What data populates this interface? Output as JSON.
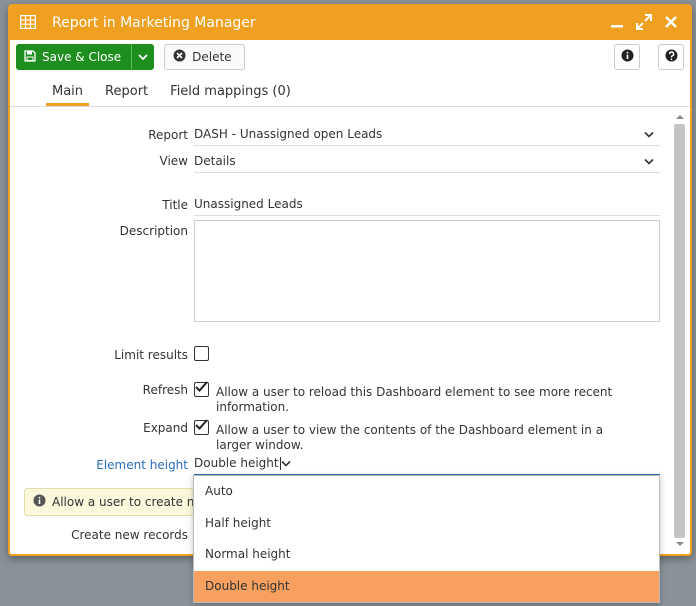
{
  "window": {
    "title": "Report in Marketing Manager"
  },
  "toolbar": {
    "save_label": "Save & Close",
    "delete_label": "Delete"
  },
  "tabs": [
    {
      "label": "Main",
      "active": true
    },
    {
      "label": "Report",
      "active": false
    },
    {
      "label": "Field mappings (0)",
      "active": false
    }
  ],
  "form": {
    "report": {
      "label": "Report",
      "value": "DASH - Unassigned open Leads"
    },
    "view": {
      "label": "View",
      "value": "Details"
    },
    "title": {
      "label": "Title",
      "value": "Unassigned Leads"
    },
    "description": {
      "label": "Description",
      "value": ""
    },
    "limit_results": {
      "label": "Limit results",
      "checked": false
    },
    "refresh": {
      "label": "Refresh",
      "checked": true,
      "text": "Allow a user to reload this Dashboard element to see more recent information."
    },
    "expand": {
      "label": "Expand",
      "checked": true,
      "text": "Allow a user to view the contents of the Dashboard element in a larger window."
    },
    "element_height": {
      "label": "Element height",
      "value": "Double height"
    },
    "info_text": "Allow a user to create new",
    "create_new_records": {
      "label": "Create new records"
    }
  },
  "dropdown": {
    "options": [
      "Auto",
      "Half height",
      "Normal height",
      "Double height"
    ],
    "selected": "Double height"
  },
  "colors": {
    "accent": "#f0a020",
    "save": "#1e8e1e",
    "selected_option": "#f8a060",
    "focus_label": "#2a6ebb"
  }
}
